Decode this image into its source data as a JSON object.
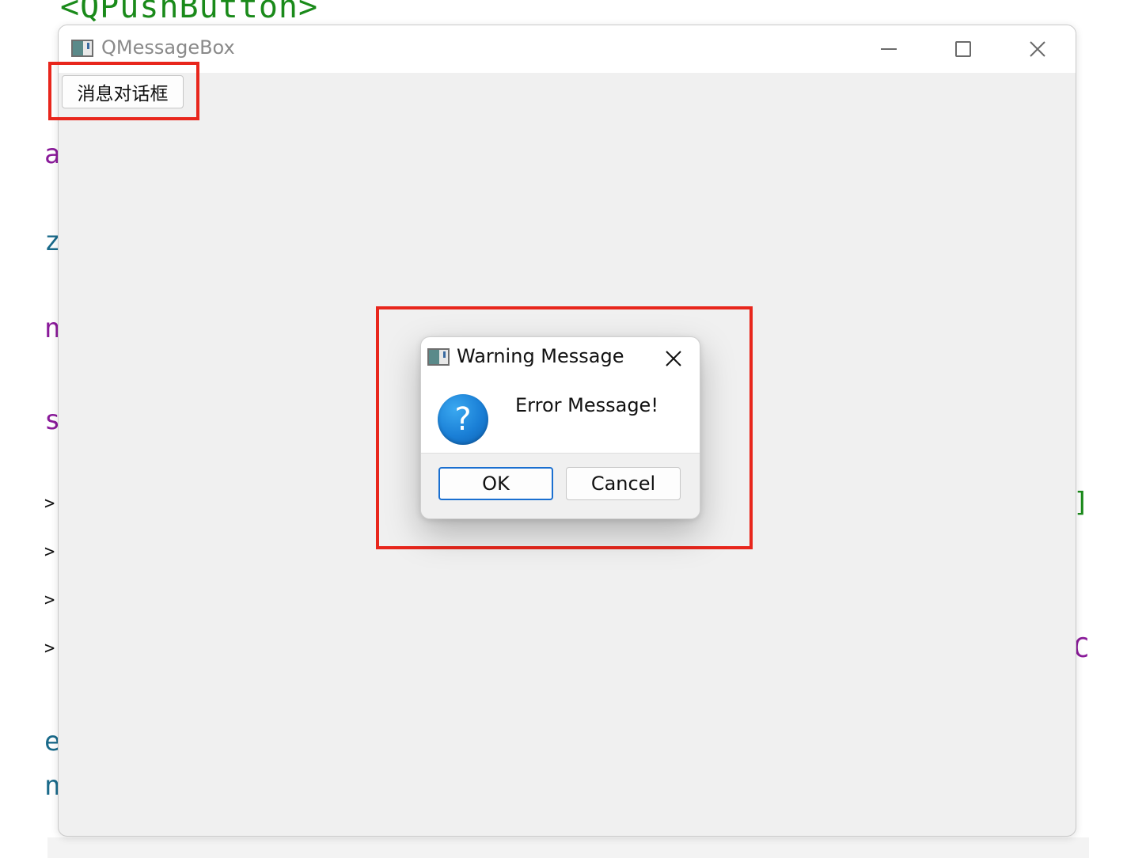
{
  "background_code": {
    "top_line": "<QPushButton>",
    "fragments": [
      {
        "text": "a",
        "color": "#8a1a9a"
      },
      {
        "text": "z",
        "color": "#1a6a8a"
      },
      {
        "text": "n",
        "color": "#8a1a9a"
      },
      {
        "text": "s",
        "color": "#8a1a9a"
      },
      {
        "text": ">",
        "color": "#111111"
      },
      {
        "text": ">",
        "color": "#111111"
      },
      {
        "text": ">",
        "color": "#111111"
      },
      {
        "text": ">",
        "color": "#111111"
      },
      {
        "text": "e",
        "color": "#1a6a8a"
      },
      {
        "text": "n",
        "color": "#1a6a8a"
      },
      {
        "text": "]",
        "color": "#1a8a1a"
      },
      {
        "text": "C",
        "color": "#8a1a9a"
      }
    ]
  },
  "main_window": {
    "title": "QMessageBox",
    "button_label": "消息对话框"
  },
  "dialog": {
    "title": "Warning Message",
    "message": "Error Message!",
    "icon_glyph": "?",
    "ok_label": "OK",
    "cancel_label": "Cancel"
  },
  "colors": {
    "annotation_red": "#e8261c",
    "question_blue": "#1a7fd6",
    "default_button_border": "#1a6fd0"
  }
}
